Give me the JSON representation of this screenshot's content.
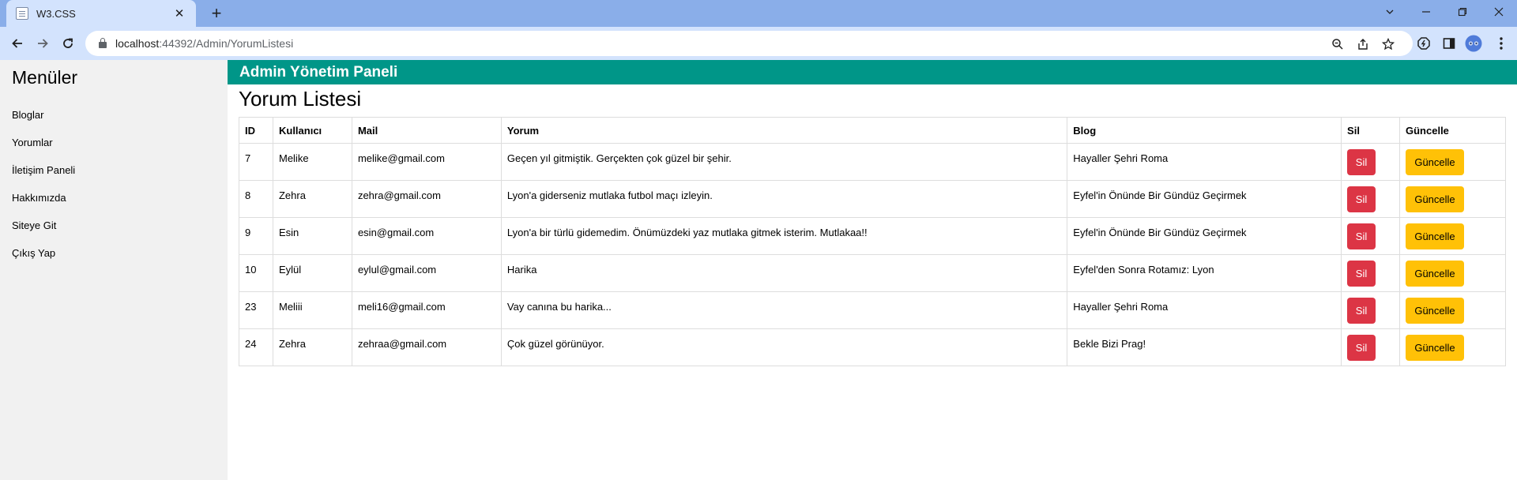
{
  "browser": {
    "tab_title": "W3.CSS",
    "tab_close": "✕",
    "new_tab": "+",
    "url_host": "localhost",
    "url_path": ":44392/Admin/YorumListesi"
  },
  "sidebar": {
    "title": "Menüler",
    "items": [
      {
        "label": "Bloglar"
      },
      {
        "label": "Yorumlar"
      },
      {
        "label": "İletişim Paneli"
      },
      {
        "label": "Hakkımızda"
      },
      {
        "label": "Siteye Git"
      },
      {
        "label": "Çıkış Yap"
      }
    ]
  },
  "header": {
    "title": "Admin Yönetim Paneli"
  },
  "main": {
    "title": "Yorum Listesi",
    "columns": [
      "ID",
      "Kullanıcı",
      "Mail",
      "Yorum",
      "Blog",
      "Sil",
      "Güncelle"
    ],
    "delete_label": "Sil",
    "update_label": "Güncelle",
    "rows": [
      {
        "id": "7",
        "user": "Melike",
        "mail": "melike@gmail.com",
        "comment": "Geçen yıl gitmiştik. Gerçekten çok güzel bir şehir.",
        "blog": "Hayaller Şehri Roma"
      },
      {
        "id": "8",
        "user": "Zehra",
        "mail": "zehra@gmail.com",
        "comment": "Lyon'a giderseniz mutlaka futbol maçı izleyin.",
        "blog": "Eyfel'in Önünde Bir Gündüz Geçirmek"
      },
      {
        "id": "9",
        "user": "Esin",
        "mail": "esin@gmail.com",
        "comment": "Lyon'a bir türlü gidemedim. Önümüzdeki yaz mutlaka gitmek isterim. Mutlakaa!!",
        "blog": "Eyfel'in Önünde Bir Gündüz Geçirmek"
      },
      {
        "id": "10",
        "user": "Eylül",
        "mail": "eylul@gmail.com",
        "comment": "Harika",
        "blog": "Eyfel'den Sonra Rotamız: Lyon"
      },
      {
        "id": "23",
        "user": "Meliii",
        "mail": "meli16@gmail.com",
        "comment": "Vay canına bu harika...",
        "blog": "Hayaller Şehri Roma"
      },
      {
        "id": "24",
        "user": "Zehra",
        "mail": "zehraa@gmail.com",
        "comment": "Çok güzel görünüyor.",
        "blog": "Bekle Bizi Prag!"
      }
    ]
  },
  "colors": {
    "header": "#009688",
    "sidebar": "#f1f1f1",
    "delete_button": "#dc3545",
    "update_button": "#ffc107"
  }
}
